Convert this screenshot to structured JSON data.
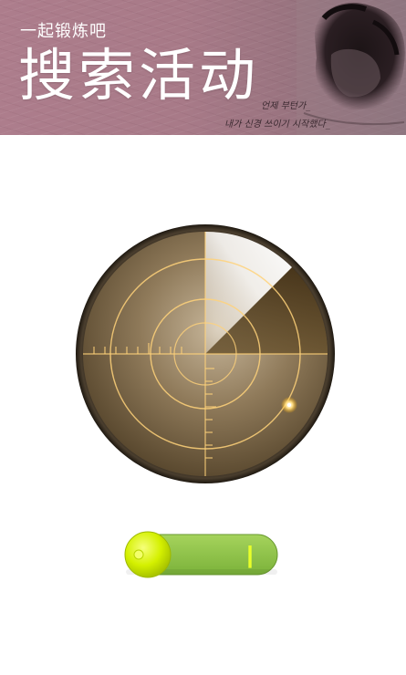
{
  "banner": {
    "subtitle": "一起锻炼吧",
    "title": "搜索活动",
    "handwriting_line1": "언제 부턴가_",
    "handwriting_line2": "내가 신경 쓰이기 시작했다_"
  },
  "toggle": {
    "state": "off",
    "on_mark": "|"
  },
  "colors": {
    "banner_bg": "#a87a88",
    "radar_bronze": "#8a6e48",
    "radar_glow": "#ffd27a",
    "toggle_track": "#8bc34a",
    "toggle_knob": "#d4f000"
  },
  "icons": {
    "radar": "radar-icon",
    "toggle": "switch-icon"
  }
}
